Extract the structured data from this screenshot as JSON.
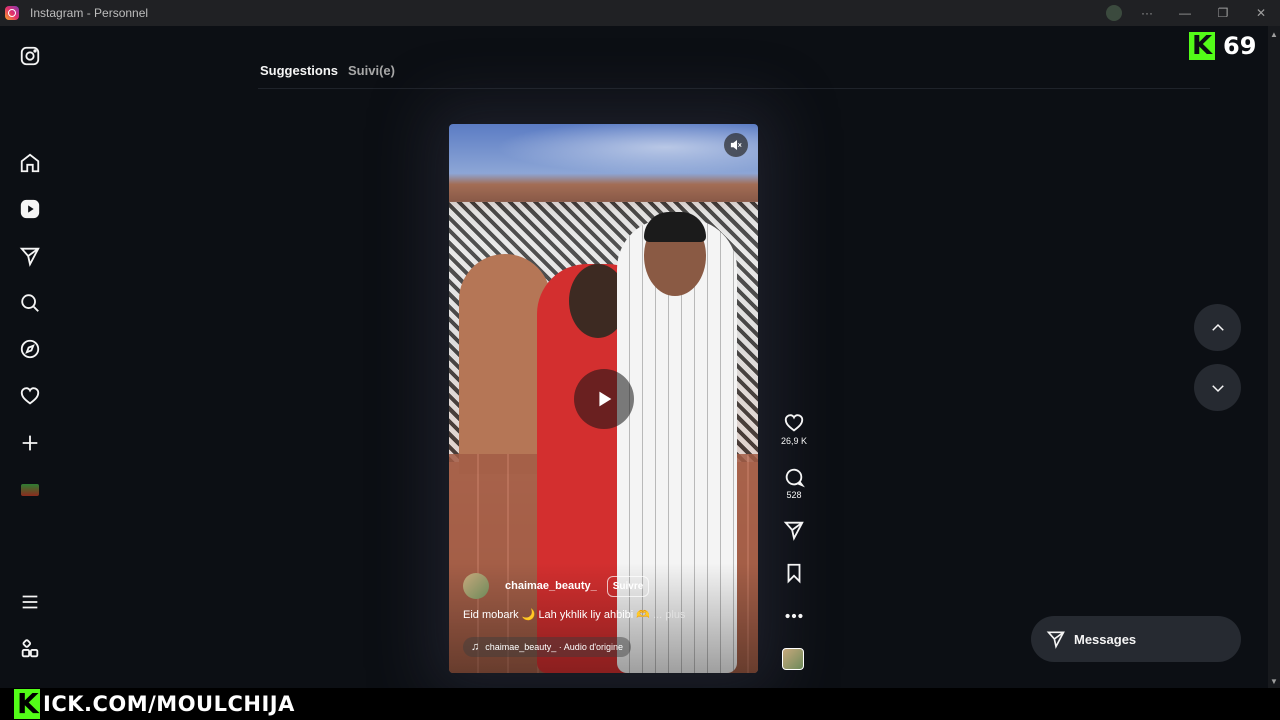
{
  "window": {
    "title": "Instagram - Personnel",
    "more_label": "···",
    "minimize": "—",
    "restore": "❐",
    "close": "✕"
  },
  "sidebar": {
    "icons": [
      "instagram-logo-icon",
      "home-icon",
      "reels-icon",
      "messages-icon",
      "search-icon",
      "explore-icon",
      "notifications-icon",
      "create-icon",
      "profile-avatar",
      "menu-icon",
      "more-apps-icon"
    ]
  },
  "tabs": {
    "suggestions": "Suggestions",
    "following": "Suivi(e)"
  },
  "reel": {
    "author": "chaimae_beauty_",
    "follow_label": "Suivre",
    "caption": "Eid mobark 🌙 Lah ykhlik liy ahbibi 🫶",
    "caption_more": "... plus",
    "audio": "chaimae_beauty_ · Audio d'origine"
  },
  "actions": {
    "likes": "26,9 K",
    "comments": "528"
  },
  "messages": {
    "label": "Messages"
  },
  "overlay": {
    "kick_count": "69",
    "kick_url": "ICK.COM/MOULCHIJA",
    "kick_letter": "K"
  },
  "colors": {
    "background": "#0c0f14",
    "accent_kick": "#53fc18",
    "button_bg": "#262a31"
  }
}
